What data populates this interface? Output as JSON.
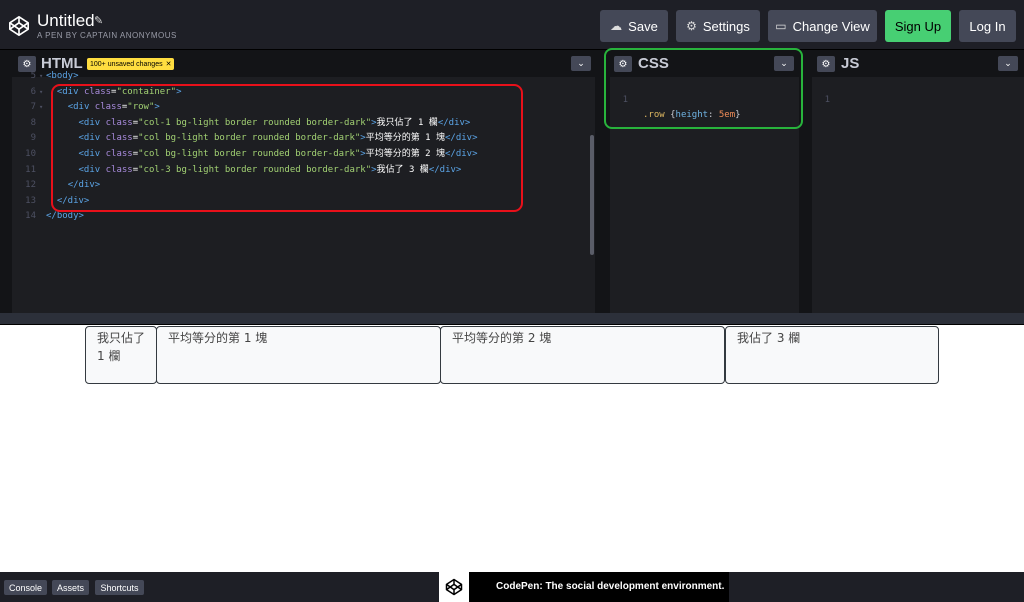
{
  "header": {
    "title": "Untitled",
    "subtitle": "A PEN BY CAPTAIN ANONYMOUS",
    "buttons": {
      "save": "Save",
      "settings": "Settings",
      "change_view": "Change View",
      "sign_up": "Sign Up",
      "log_in": "Log In"
    }
  },
  "editors": {
    "html": {
      "label": "HTML",
      "badge": "100+ unsaved changes",
      "lines": [
        {
          "num": "5",
          "fold": true,
          "text": "<body>"
        },
        {
          "num": "6",
          "fold": true,
          "indent": "  ",
          "tag_open": "<div ",
          "attr": "class",
          "value": "\"container\"",
          "tag_close": ">"
        },
        {
          "num": "7",
          "fold": true,
          "indent": "    ",
          "tag_open": "<div ",
          "attr": "class",
          "value": "\"row\"",
          "tag_close": ">"
        },
        {
          "num": "8",
          "fold": false,
          "indent": "      ",
          "tag_open": "<div ",
          "attr": "class",
          "value": "\"col-1 bg-light border rounded border-dark\"",
          "tag_close": ">",
          "content": "我只佔了 1 欄",
          "end_tag": "</div>"
        },
        {
          "num": "9",
          "fold": false,
          "indent": "      ",
          "tag_open": "<div ",
          "attr": "class",
          "value": "\"col bg-light border rounded border-dark\"",
          "tag_close": ">",
          "content": "平均等分的第 1 塊",
          "end_tag": "</div>"
        },
        {
          "num": "10",
          "fold": false,
          "indent": "      ",
          "tag_open": "<div ",
          "attr": "class",
          "value": "\"col bg-light border rounded border-dark\"",
          "tag_close": ">",
          "content": "平均等分的第 2 塊",
          "end_tag": "</div>"
        },
        {
          "num": "11",
          "fold": false,
          "indent": "      ",
          "tag_open": "<div ",
          "attr": "class",
          "value": "\"col-3 bg-light border rounded border-dark\"",
          "tag_close": ">",
          "content": "我佔了 3 欄",
          "end_tag": "</div>"
        },
        {
          "num": "12",
          "fold": false,
          "indent": "    ",
          "tag_open": "</div>"
        },
        {
          "num": "13",
          "fold": false,
          "indent": "  ",
          "tag_open": "</div>"
        },
        {
          "num": "14",
          "fold": false,
          "indent": "",
          "tag_open": "</body>"
        }
      ]
    },
    "css": {
      "label": "CSS",
      "line_num": "1",
      "selector": ".row",
      "brace_open": " {",
      "property": "height",
      "colon": ": ",
      "value": "5em",
      "brace_close": "}"
    },
    "js": {
      "label": "JS",
      "line_num": "1"
    }
  },
  "preview": {
    "cells": [
      "我只佔了 1 欄",
      "平均等分的第 1 塊",
      "平均等分的第 2 塊",
      "我佔了 3 欄"
    ]
  },
  "footer": {
    "console": "Console",
    "assets": "Assets",
    "shortcuts": "Shortcuts",
    "promo": "CodePen: The social development environment."
  },
  "colors": {
    "header_bg": "#1e1f26",
    "editor_bg": "#1d1e22",
    "signup_green": "#47cf73",
    "badge_yellow": "#ffdd40",
    "highlight_red": "#e8101a",
    "highlight_green": "#28b33c"
  }
}
